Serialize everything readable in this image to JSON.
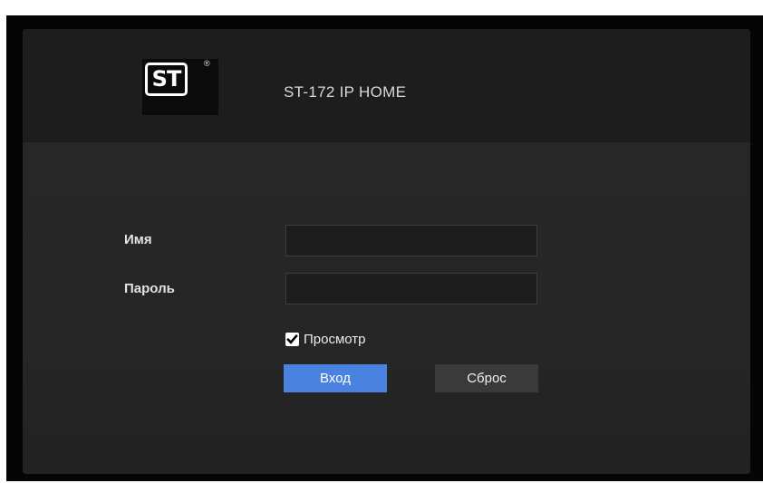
{
  "header": {
    "app_title": "ST-172 IP HOME",
    "logo_text": "ST",
    "logo_reg": "®"
  },
  "form": {
    "username_label": "Имя",
    "username_value": "",
    "password_label": "Пароль",
    "password_value": "",
    "preview_checkbox_label": "Просмотр",
    "preview_checked": true,
    "login_button": "Вход",
    "reset_button": "Сброс"
  },
  "colors": {
    "accent": "#4a82e0",
    "panel": "#232323",
    "header": "#1d1d1d"
  }
}
